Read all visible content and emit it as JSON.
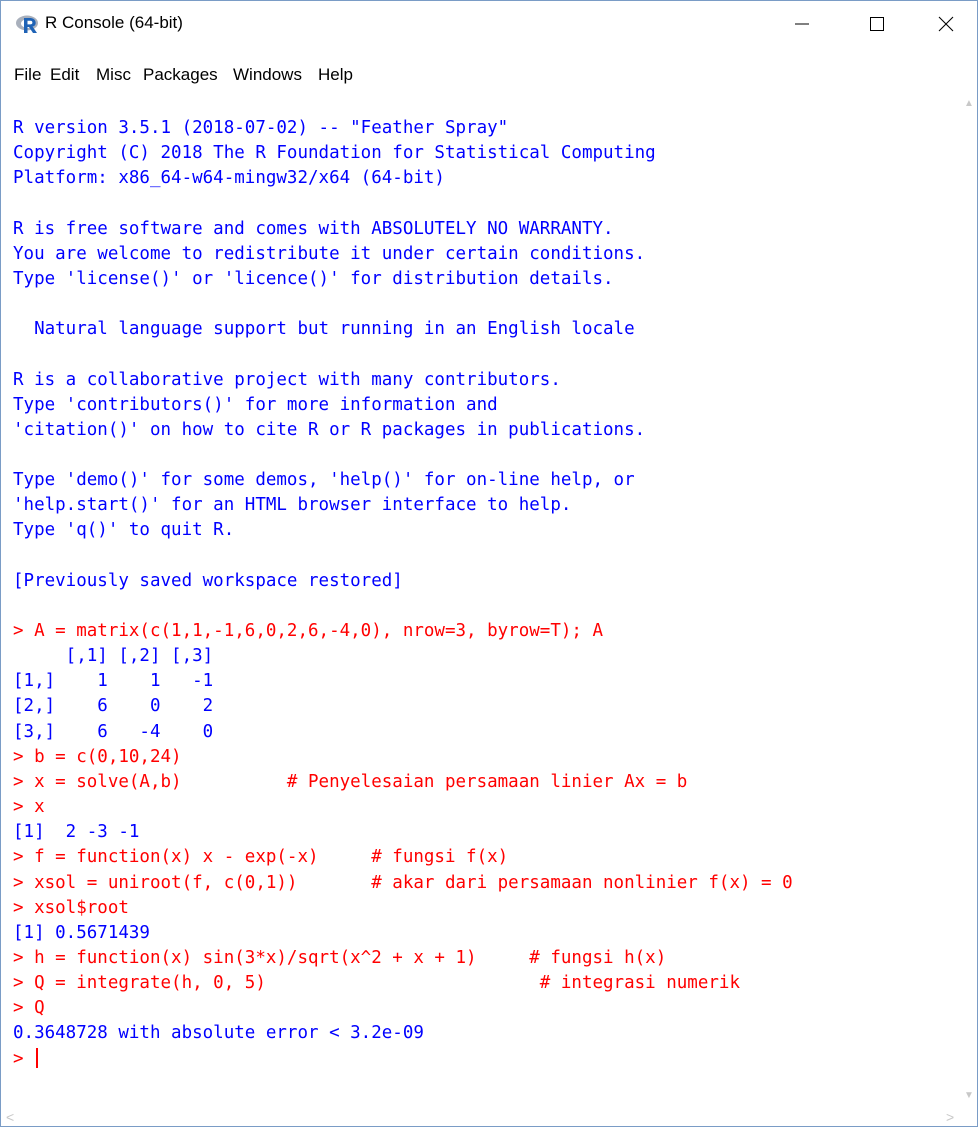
{
  "window": {
    "title": "R Console (64-bit)",
    "icon": "r-logo-icon",
    "controls": {
      "minimize": "minimize-icon",
      "maximize": "maximize-icon",
      "close": "close-icon"
    }
  },
  "menu": [
    "File",
    "Edit",
    "Misc",
    "Packages",
    "Windows",
    "Help"
  ],
  "console": {
    "lines": [
      {
        "type": "out",
        "text": "R version 3.5.1 (2018-07-02) -- \"Feather Spray\""
      },
      {
        "type": "out",
        "text": "Copyright (C) 2018 The R Foundation for Statistical Computing"
      },
      {
        "type": "out",
        "text": "Platform: x86_64-w64-mingw32/x64 (64-bit)"
      },
      {
        "type": "out",
        "text": ""
      },
      {
        "type": "out",
        "text": "R is free software and comes with ABSOLUTELY NO WARRANTY."
      },
      {
        "type": "out",
        "text": "You are welcome to redistribute it under certain conditions."
      },
      {
        "type": "out",
        "text": "Type 'license()' or 'licence()' for distribution details."
      },
      {
        "type": "out",
        "text": ""
      },
      {
        "type": "out",
        "text": "  Natural language support but running in an English locale"
      },
      {
        "type": "out",
        "text": ""
      },
      {
        "type": "out",
        "text": "R is a collaborative project with many contributors."
      },
      {
        "type": "out",
        "text": "Type 'contributors()' for more information and"
      },
      {
        "type": "out",
        "text": "'citation()' on how to cite R or R packages in publications."
      },
      {
        "type": "out",
        "text": ""
      },
      {
        "type": "out",
        "text": "Type 'demo()' for some demos, 'help()' for on-line help, or"
      },
      {
        "type": "out",
        "text": "'help.start()' for an HTML browser interface to help."
      },
      {
        "type": "out",
        "text": "Type 'q()' to quit R."
      },
      {
        "type": "out",
        "text": ""
      },
      {
        "type": "out",
        "text": "[Previously saved workspace restored]"
      },
      {
        "type": "out",
        "text": ""
      },
      {
        "type": "in",
        "text": "> A = matrix(c(1,1,-1,6,0,2,6,-4,0), nrow=3, byrow=T); A"
      },
      {
        "type": "out",
        "text": "     [,1] [,2] [,3]"
      },
      {
        "type": "out",
        "text": "[1,]    1    1   -1"
      },
      {
        "type": "out",
        "text": "[2,]    6    0    2"
      },
      {
        "type": "out",
        "text": "[3,]    6   -4    0"
      },
      {
        "type": "in",
        "text": "> b = c(0,10,24)"
      },
      {
        "type": "in",
        "text": "> x = solve(A,b)          # Penyelesaian persamaan linier Ax = b"
      },
      {
        "type": "in",
        "text": "> x"
      },
      {
        "type": "out",
        "text": "[1]  2 -3 -1"
      },
      {
        "type": "in",
        "text": "> f = function(x) x - exp(-x)     # fungsi f(x)"
      },
      {
        "type": "in",
        "text": "> xsol = uniroot(f, c(0,1))       # akar dari persamaan nonlinier f(x) = 0"
      },
      {
        "type": "in",
        "text": "> xsol$root"
      },
      {
        "type": "out",
        "text": "[1] 0.5671439"
      },
      {
        "type": "in",
        "text": "> h = function(x) sin(3*x)/sqrt(x^2 + x + 1)     # fungsi h(x)"
      },
      {
        "type": "in",
        "text": "> Q = integrate(h, 0, 5)                          # integrasi numerik"
      },
      {
        "type": "in",
        "text": "> Q"
      },
      {
        "type": "out",
        "text": "0.3648728 with absolute error < 3.2e-09"
      }
    ],
    "prompt": "> "
  }
}
